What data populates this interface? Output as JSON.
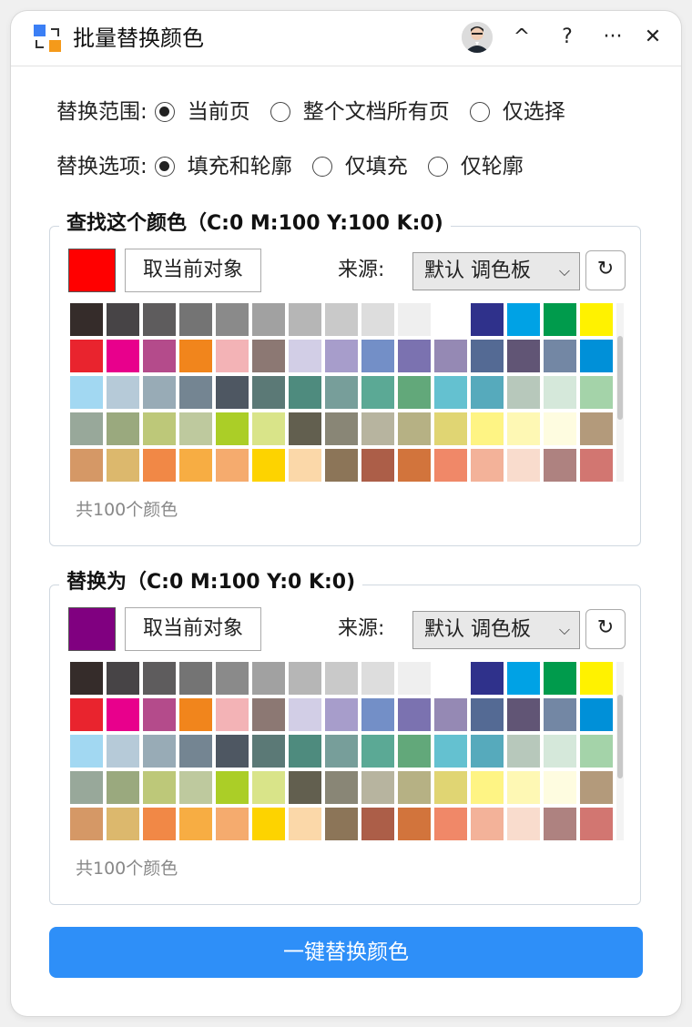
{
  "window": {
    "title": "批量替换颜色",
    "buttons": {
      "collapse": "^",
      "help": "?",
      "more": "···",
      "close": "✕"
    }
  },
  "scope": {
    "label": "替换范围:",
    "options": [
      {
        "label": "当前页",
        "selected": true
      },
      {
        "label": "整个文档所有页",
        "selected": false
      },
      {
        "label": "仅选择",
        "selected": false
      }
    ]
  },
  "options": {
    "label": "替换选项:",
    "options": [
      {
        "label": "填充和轮廓",
        "selected": true
      },
      {
        "label": "仅填充",
        "selected": false
      },
      {
        "label": "仅轮廓",
        "selected": false
      }
    ]
  },
  "find": {
    "title": "查找这个颜色（C:0 M:100 Y:100 K:0)",
    "current_color": "#ff0000",
    "pick_button": "取当前对象",
    "source_label": "来源:",
    "source_value": "默认 调色板",
    "refresh_icon": "↻",
    "count_text": "共100个颜色"
  },
  "replace": {
    "title": "替换为（C:0 M:100 Y:0 K:0)",
    "current_color": "#800080",
    "pick_button": "取当前对象",
    "source_label": "来源:",
    "source_value": "默认 调色板",
    "refresh_icon": "↻",
    "count_text": "共100个颜色"
  },
  "palette_colors": [
    [
      "#352c2a",
      "#474446",
      "#5e5c5d",
      "#747474",
      "#8a8a8a",
      "#a1a1a1",
      "#b6b6b6",
      "#c9c9c9",
      "#dddddd",
      "#efefef",
      "#ffffff",
      "#2f318b",
      "#00a2e5",
      "#009b4c",
      "#fff200"
    ],
    [
      "#e9242e",
      "#e8008c",
      "#b44b8b",
      "#f1851c",
      "#f3b3b6",
      "#8c7873",
      "#d2cee6",
      "#a79dcb",
      "#738fc7",
      "#7b72b0",
      "#9589b4",
      "#546a94",
      "#615575",
      "#7387a4",
      "#0090d8"
    ],
    [
      "#a2d8f2",
      "#b6cad8",
      "#98abb6",
      "#748592",
      "#4e5762",
      "#5b7976",
      "#4e8b7e",
      "#779e9a",
      "#5ba995",
      "#62a87a",
      "#64c1d0",
      "#56aabc",
      "#b7c8bb",
      "#d5e8da",
      "#a4d3a9"
    ],
    [
      "#98a89a",
      "#9aa97e",
      "#bdc879",
      "#bec99e",
      "#abce27",
      "#d9e489",
      "#625f4f",
      "#898676",
      "#b7b49f",
      "#b6b184",
      "#e0d573",
      "#fef484",
      "#fef8b4",
      "#fefce0",
      "#b39a7b"
    ],
    [
      "#d59866",
      "#dcb86d",
      "#f18846",
      "#f7ad43",
      "#f5ab6e",
      "#fdd300",
      "#fbd8a9",
      "#8c7558",
      "#ac5e48",
      "#d2743c",
      "#f08868",
      "#f3b299",
      "#f9dccd",
      "#ae8280",
      "#d27671"
    ]
  ],
  "action": {
    "label": "一键替换颜色"
  }
}
